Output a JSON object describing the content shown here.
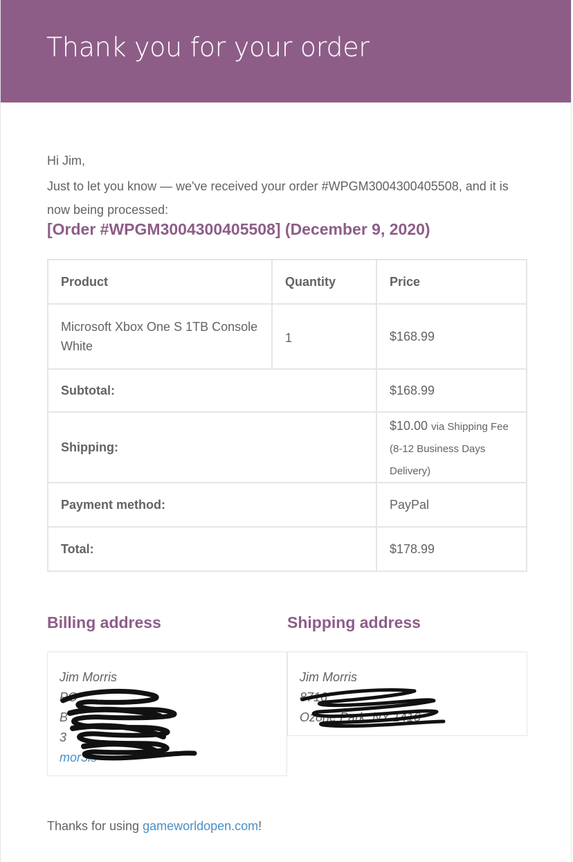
{
  "header": {
    "title": "Thank you for your order",
    "background": "#8d5d88"
  },
  "email": {
    "greeting": "Hi Jim,",
    "intro": "Just to let you know — we've received your order #WPGM3004300405508, and it is now being processed:",
    "order_heading": "[Order #WPGM3004300405508] (December 9, 2020)"
  },
  "order_table": {
    "headers": [
      "Product",
      "Quantity",
      "Price"
    ],
    "items": [
      {
        "product": "Microsoft Xbox One S 1TB Console White",
        "quantity": "1",
        "price": "$168.99"
      }
    ],
    "totals": {
      "subtotal_label": "Subtotal:",
      "subtotal_value": "$168.99",
      "shipping_label": "Shipping:",
      "shipping_amount": "$10.00",
      "shipping_via": "via Shipping Fee (8-12 Business Days Delivery)",
      "payment_label": "Payment method:",
      "payment_value": "PayPal",
      "total_label": "Total:",
      "total_value": "$178.99"
    }
  },
  "billing": {
    "title": "Billing address",
    "name": "Jim Morris",
    "line1": "PO",
    "line2": "B",
    "line3": "3",
    "email": "mor3is"
  },
  "shipping": {
    "title": "Shipping address",
    "name": "Jim Morris",
    "line1": "8716",
    "line2": "Ozone Park, NY 1416"
  },
  "footer": {
    "prefix": "Thanks for using ",
    "link": "gameworldopen.com",
    "suffix": "!"
  },
  "colors": {
    "accent": "#8d5d88",
    "link": "#4a90c6",
    "text": "#636363",
    "border": "#e5e5e5"
  }
}
